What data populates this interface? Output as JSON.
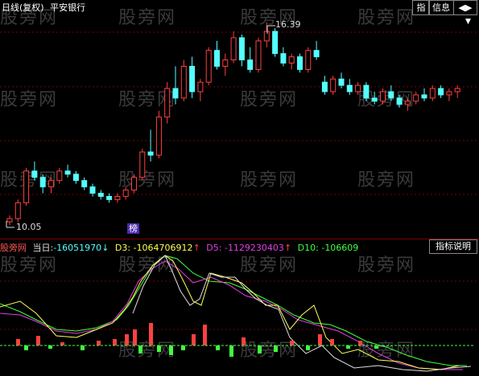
{
  "header": {
    "period": "日线(复权)",
    "stock": "平安银行",
    "btn_zhi": "指",
    "btn_info": "信息",
    "btn_arrows": "◀▶"
  },
  "price_chart": {
    "high_label": "16.39",
    "low_label": "10.05",
    "badge": "榜"
  },
  "indicator": {
    "name": "股旁网",
    "dangri_label": "当日:",
    "dangri_value": "-16051970",
    "d3_label": "D3:",
    "d3_value": "-1064706912",
    "d5_label": "D5:",
    "d5_value": "-1129230403",
    "d10_label": "D10:",
    "d10_value": "-106609",
    "button": "指标说明"
  },
  "watermark": "股旁网",
  "colors": {
    "up": "#ff4040",
    "down": "#54ffff",
    "dangri": "#e0e0e0",
    "d3": "#ffff54",
    "d5": "#e040e0",
    "d10": "#40ff40",
    "grid": "#7a0000"
  },
  "chart_data": {
    "type": "candlestick",
    "candles": [
      {
        "o": 10.1,
        "h": 10.3,
        "l": 10.0,
        "c": 10.2
      },
      {
        "o": 10.2,
        "h": 10.8,
        "l": 10.1,
        "c": 10.7
      },
      {
        "o": 10.7,
        "h": 11.8,
        "l": 10.6,
        "c": 11.7
      },
      {
        "o": 11.7,
        "h": 12.0,
        "l": 11.4,
        "c": 11.5
      },
      {
        "o": 11.5,
        "h": 11.6,
        "l": 11.0,
        "c": 11.2
      },
      {
        "o": 11.2,
        "h": 11.5,
        "l": 11.0,
        "c": 11.4
      },
      {
        "o": 11.4,
        "h": 11.8,
        "l": 11.3,
        "c": 11.7
      },
      {
        "o": 11.7,
        "h": 11.9,
        "l": 11.5,
        "c": 11.6
      },
      {
        "o": 11.6,
        "h": 11.7,
        "l": 11.3,
        "c": 11.4
      },
      {
        "o": 11.4,
        "h": 11.5,
        "l": 11.1,
        "c": 11.2
      },
      {
        "o": 11.2,
        "h": 11.3,
        "l": 10.9,
        "c": 11.0
      },
      {
        "o": 11.0,
        "h": 11.1,
        "l": 10.8,
        "c": 10.9
      },
      {
        "o": 10.9,
        "h": 11.0,
        "l": 10.7,
        "c": 10.8
      },
      {
        "o": 10.8,
        "h": 11.0,
        "l": 10.7,
        "c": 10.9
      },
      {
        "o": 10.9,
        "h": 11.2,
        "l": 10.8,
        "c": 11.1
      },
      {
        "o": 11.1,
        "h": 11.6,
        "l": 11.0,
        "c": 11.5
      },
      {
        "o": 11.5,
        "h": 12.4,
        "l": 11.4,
        "c": 12.3
      },
      {
        "o": 12.3,
        "h": 13.0,
        "l": 12.0,
        "c": 12.2
      },
      {
        "o": 12.2,
        "h": 13.6,
        "l": 12.1,
        "c": 13.4
      },
      {
        "o": 13.4,
        "h": 14.5,
        "l": 13.2,
        "c": 14.3
      },
      {
        "o": 14.3,
        "h": 15.0,
        "l": 13.8,
        "c": 14.0
      },
      {
        "o": 14.0,
        "h": 15.2,
        "l": 13.9,
        "c": 15.0
      },
      {
        "o": 15.0,
        "h": 15.3,
        "l": 14.0,
        "c": 14.2
      },
      {
        "o": 14.2,
        "h": 14.6,
        "l": 13.9,
        "c": 14.5
      },
      {
        "o": 14.5,
        "h": 15.6,
        "l": 14.4,
        "c": 15.5
      },
      {
        "o": 15.5,
        "h": 15.8,
        "l": 14.9,
        "c": 15.0
      },
      {
        "o": 15.0,
        "h": 15.4,
        "l": 14.7,
        "c": 15.2
      },
      {
        "o": 15.2,
        "h": 16.1,
        "l": 15.1,
        "c": 15.9
      },
      {
        "o": 15.9,
        "h": 16.0,
        "l": 15.0,
        "c": 15.2
      },
      {
        "o": 15.2,
        "h": 15.6,
        "l": 14.8,
        "c": 14.9
      },
      {
        "o": 14.9,
        "h": 15.9,
        "l": 14.8,
        "c": 15.8
      },
      {
        "o": 15.8,
        "h": 16.39,
        "l": 15.6,
        "c": 16.1
      },
      {
        "o": 16.1,
        "h": 16.2,
        "l": 15.3,
        "c": 15.4
      },
      {
        "o": 15.4,
        "h": 15.6,
        "l": 15.0,
        "c": 15.1
      },
      {
        "o": 15.1,
        "h": 15.4,
        "l": 14.9,
        "c": 15.3
      },
      {
        "o": 15.3,
        "h": 15.4,
        "l": 14.8,
        "c": 14.9
      },
      {
        "o": 14.9,
        "h": 15.6,
        "l": 14.8,
        "c": 15.5
      },
      {
        "o": 15.5,
        "h": 15.8,
        "l": 15.2,
        "c": 15.3
      },
      {
        "o": 14.5,
        "h": 14.7,
        "l": 14.1,
        "c": 14.2
      },
      {
        "o": 14.2,
        "h": 14.7,
        "l": 14.1,
        "c": 14.6
      },
      {
        "o": 14.6,
        "h": 14.8,
        "l": 14.3,
        "c": 14.4
      },
      {
        "o": 14.4,
        "h": 14.6,
        "l": 14.1,
        "c": 14.2
      },
      {
        "o": 14.2,
        "h": 14.5,
        "l": 14.1,
        "c": 14.4
      },
      {
        "o": 14.4,
        "h": 14.5,
        "l": 13.9,
        "c": 14.0
      },
      {
        "o": 14.0,
        "h": 14.2,
        "l": 13.8,
        "c": 13.9
      },
      {
        "o": 13.9,
        "h": 14.3,
        "l": 13.8,
        "c": 14.2
      },
      {
        "o": 14.2,
        "h": 14.4,
        "l": 13.9,
        "c": 14.0
      },
      {
        "o": 14.0,
        "h": 14.1,
        "l": 13.7,
        "c": 13.8
      },
      {
        "o": 13.8,
        "h": 14.0,
        "l": 13.6,
        "c": 13.9
      },
      {
        "o": 13.9,
        "h": 14.2,
        "l": 13.8,
        "c": 14.1
      },
      {
        "o": 14.1,
        "h": 14.3,
        "l": 13.9,
        "c": 14.0
      },
      {
        "o": 14.0,
        "h": 14.4,
        "l": 13.9,
        "c": 14.3
      },
      {
        "o": 14.3,
        "h": 14.4,
        "l": 14.0,
        "c": 14.1
      },
      {
        "o": 14.1,
        "h": 14.3,
        "l": 13.9,
        "c": 14.2
      },
      {
        "o": 14.2,
        "h": 14.4,
        "l": 14.0,
        "c": 14.3
      }
    ]
  }
}
